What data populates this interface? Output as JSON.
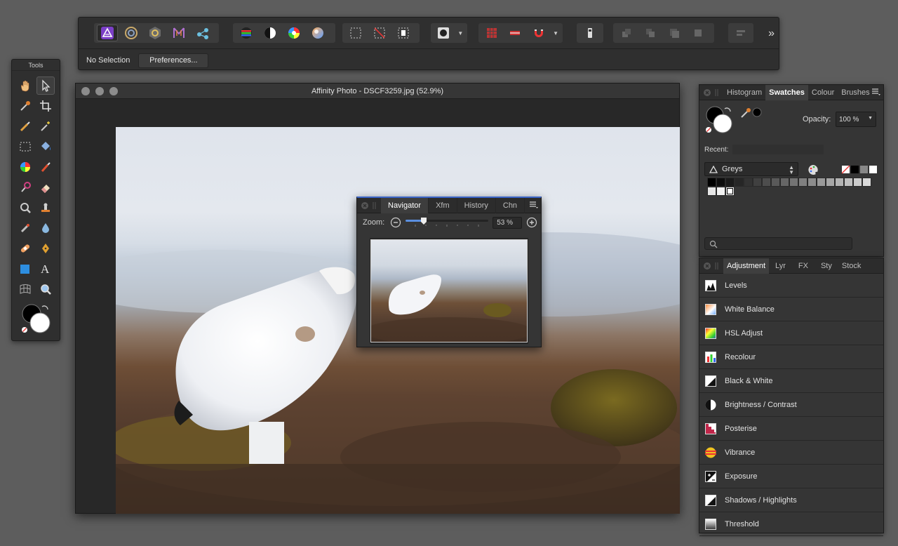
{
  "toolbar": {
    "context_label": "No Selection",
    "preferences_label": "Preferences...",
    "more_glyph": "»"
  },
  "tools": {
    "title": "Tools",
    "items": [
      {
        "name": "view-tool",
        "icon": "hand-icon"
      },
      {
        "name": "move-tool",
        "icon": "pointer-icon"
      },
      {
        "name": "colour-picker-tool",
        "icon": "eyedropper-icon"
      },
      {
        "name": "crop-tool",
        "icon": "crop-icon"
      },
      {
        "name": "selection-brush-tool",
        "icon": "selection-brush-icon"
      },
      {
        "name": "flood-select-tool",
        "icon": "magic-wand-icon"
      },
      {
        "name": "marquee-tool",
        "icon": "marquee-icon"
      },
      {
        "name": "flood-fill-tool",
        "icon": "bucket-icon"
      },
      {
        "name": "gradient-tool",
        "icon": "colour-wheel-icon"
      },
      {
        "name": "paint-brush-tool",
        "icon": "brush-icon"
      },
      {
        "name": "dodge-burn-tool",
        "icon": "dodge-icon"
      },
      {
        "name": "erase-tool",
        "icon": "eraser-icon"
      },
      {
        "name": "zoom-blur-tool",
        "icon": "magnifier-small-icon"
      },
      {
        "name": "clone-tool",
        "icon": "stamp-icon"
      },
      {
        "name": "smudge-tool",
        "icon": "smudge-icon"
      },
      {
        "name": "blur-tool",
        "icon": "drop-icon"
      },
      {
        "name": "healing-tool",
        "icon": "bandage-icon"
      },
      {
        "name": "pen-tool",
        "icon": "pen-nib-icon"
      },
      {
        "name": "rectangle-tool",
        "icon": "square-icon"
      },
      {
        "name": "text-tool",
        "icon": "text-icon"
      },
      {
        "name": "mesh-warp-tool",
        "icon": "mesh-icon"
      },
      {
        "name": "zoom-tool",
        "icon": "zoom-icon"
      }
    ]
  },
  "document": {
    "title": "Affinity Photo - DSCF3259.jpg (52.9%)"
  },
  "navigator": {
    "tabs": [
      "Navigator",
      "Xfm",
      "History",
      "Chn"
    ],
    "selected_tab": "Navigator",
    "zoom_label": "Zoom:",
    "zoom_value": "53 %",
    "zoom_fraction": 0.22
  },
  "swatches_panel": {
    "tabs": [
      "Histogram",
      "Swatches",
      "Colour",
      "Brushes"
    ],
    "selected_tab": "Swatches",
    "opacity_label": "Opacity:",
    "opacity_value": "100 %",
    "recent_label": "Recent:",
    "palette_name": "Greys",
    "greys": [
      "#000000",
      "#0d0d0d",
      "#1a1a1a",
      "#262626",
      "#333333",
      "#404040",
      "#4d4d4d",
      "#595959",
      "#666666",
      "#737373",
      "#808080",
      "#8c8c8c",
      "#999999",
      "#a6a6a6",
      "#b3b3b3",
      "#bfbfbf",
      "#cccccc",
      "#d9d9d9",
      "#e6e6e6",
      "#f2f2f2",
      "#ffffff"
    ]
  },
  "adjustment_panel": {
    "tabs": [
      "Adjustment",
      "Lyr",
      "FX",
      "Sty",
      "Stock"
    ],
    "selected_tab": "Adjustment",
    "items": [
      {
        "label": "Levels",
        "icon": "levels-icon"
      },
      {
        "label": "White Balance",
        "icon": "white-balance-icon"
      },
      {
        "label": "HSL Adjust",
        "icon": "hsl-icon"
      },
      {
        "label": "Recolour",
        "icon": "recolour-icon"
      },
      {
        "label": "Black & White",
        "icon": "black-white-icon"
      },
      {
        "label": "Brightness / Contrast",
        "icon": "brightness-contrast-icon"
      },
      {
        "label": "Posterise",
        "icon": "posterise-icon"
      },
      {
        "label": "Vibrance",
        "icon": "vibrance-icon"
      },
      {
        "label": "Exposure",
        "icon": "exposure-icon"
      },
      {
        "label": "Shadows / Highlights",
        "icon": "shadows-highlights-icon"
      },
      {
        "label": "Threshold",
        "icon": "threshold-icon"
      }
    ]
  }
}
